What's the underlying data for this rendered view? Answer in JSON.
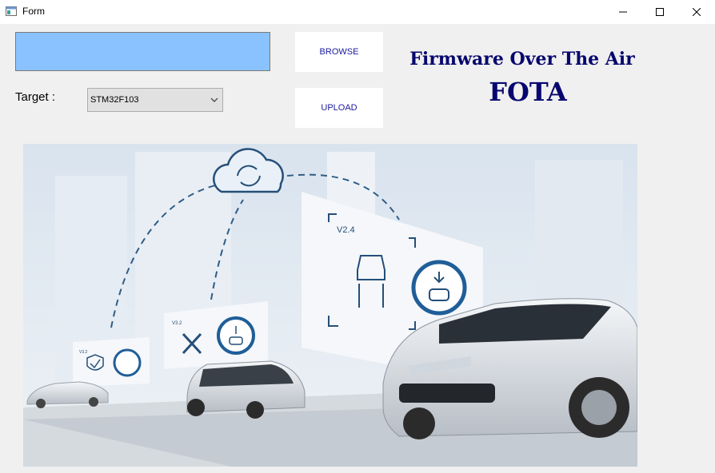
{
  "window": {
    "title": "Form",
    "controls": [
      "minimize-icon",
      "maximize-icon",
      "close-icon"
    ]
  },
  "file_path": {
    "value": ""
  },
  "buttons": {
    "browse": "BROWSE",
    "upload": "UPLOAD"
  },
  "target": {
    "label": "Target :",
    "selected": "STM32F103"
  },
  "heading": {
    "line1": "Firmware Over The Air",
    "line2": "FOTA"
  },
  "illustration": {
    "icon": "connected-car-ota-update-illustration",
    "badges": [
      "V2.4",
      "V3.2",
      "V3.2"
    ]
  },
  "colors": {
    "path_field": "#8ac2ff",
    "heading": "#06066e",
    "button_text": "#1a1a9c"
  }
}
